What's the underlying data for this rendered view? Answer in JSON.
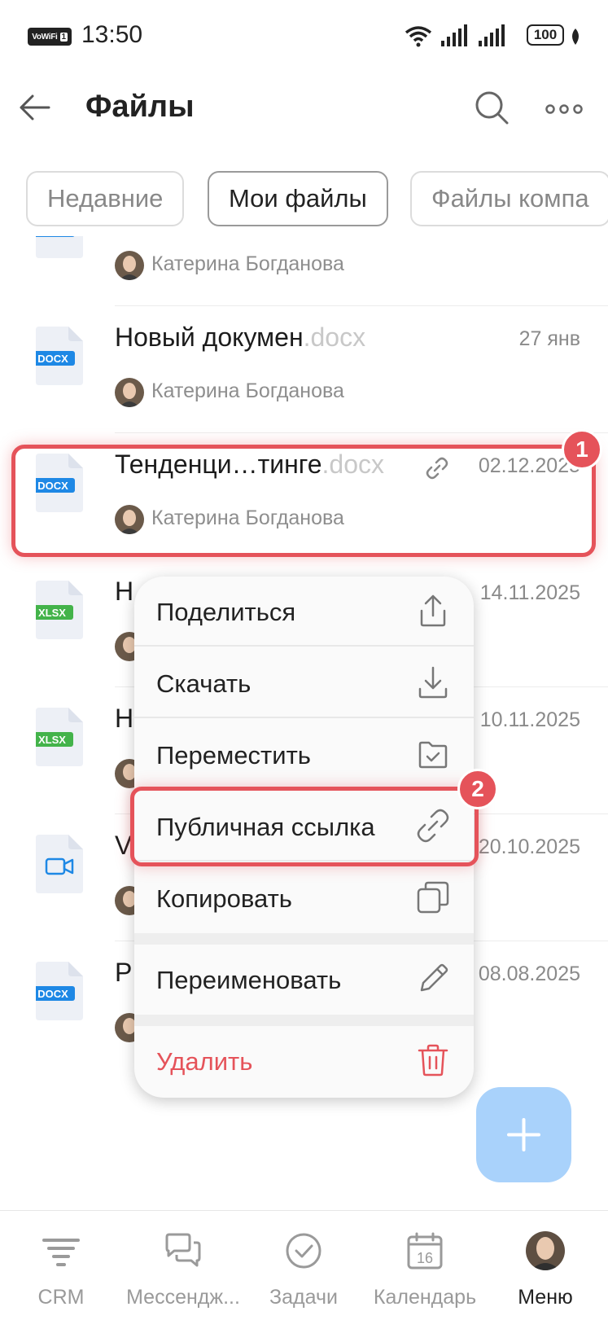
{
  "status_bar": {
    "wifi_badge": "VoWiFi",
    "sim": "1",
    "time": "13:50",
    "battery": "100"
  },
  "header": {
    "title": "Файлы"
  },
  "tabs": [
    {
      "label": "Недавние",
      "active": false
    },
    {
      "label": "Мои файлы",
      "active": true
    },
    {
      "label": "Файлы компа",
      "active": false
    }
  ],
  "files": [
    {
      "name": "",
      "ext": "",
      "date": "",
      "author": "Катерина Богданова",
      "type": "DOCX",
      "icon": "docx-icon",
      "shared": false
    },
    {
      "name": "Новый докумен",
      "ext": ".docx",
      "date": "27 янв",
      "author": "Катерина Богданова",
      "type": "DOCX",
      "icon": "docx-icon",
      "shared": false
    },
    {
      "name": "Тенденци…тинге",
      "ext": ".docx",
      "date": "02.12.2025",
      "author": "Катерина Богданова",
      "type": "DOCX",
      "icon": "docx-icon",
      "shared": true
    },
    {
      "name": "Н",
      "ext": "",
      "date": "14.11.2025",
      "author": "",
      "type": "XLSX",
      "icon": "xlsx-icon",
      "shared": false
    },
    {
      "name": "Н",
      "ext": "",
      "date": "10.11.2025",
      "author": "",
      "type": "XLSX",
      "icon": "xlsx-icon",
      "shared": false
    },
    {
      "name": "V",
      "ext": "",
      "date": "20.10.2025",
      "author": "",
      "type": "",
      "icon": "video-icon",
      "shared": false
    },
    {
      "name": "Р",
      "ext": "",
      "date": "08.08.2025",
      "author": "",
      "type": "DOCX",
      "icon": "docx-icon",
      "shared": false
    }
  ],
  "badges": {
    "first": "1",
    "second": "2"
  },
  "context_menu": {
    "items": [
      {
        "label": "Поделиться",
        "icon": "share-icon"
      },
      {
        "label": "Скачать",
        "icon": "download-icon"
      },
      {
        "label": "Переместить",
        "icon": "folder-move-icon"
      },
      {
        "label": "Публичная ссылка",
        "icon": "link-icon"
      },
      {
        "label": "Копировать",
        "icon": "copy-icon"
      },
      {
        "label": "Переименовать",
        "icon": "pencil-icon"
      },
      {
        "label": "Удалить",
        "icon": "trash-icon"
      }
    ]
  },
  "nav": [
    {
      "label": "CRM",
      "icon": "crm-icon",
      "active": false
    },
    {
      "label": "Мессендж...",
      "icon": "messenger-icon",
      "active": false
    },
    {
      "label": "Задачи",
      "icon": "tasks-icon",
      "active": false
    },
    {
      "label": "Календарь",
      "icon": "calendar-icon",
      "calendar_day": "16",
      "active": false
    },
    {
      "label": "Меню",
      "icon": "menu-avatar",
      "active": true
    }
  ],
  "colors": {
    "accent_red": "#e5535a",
    "docx_blue": "#1e88e5",
    "xlsx_green": "#43b34a",
    "fab_blue": "#a9d2fb",
    "delete_red": "#e5535a"
  }
}
